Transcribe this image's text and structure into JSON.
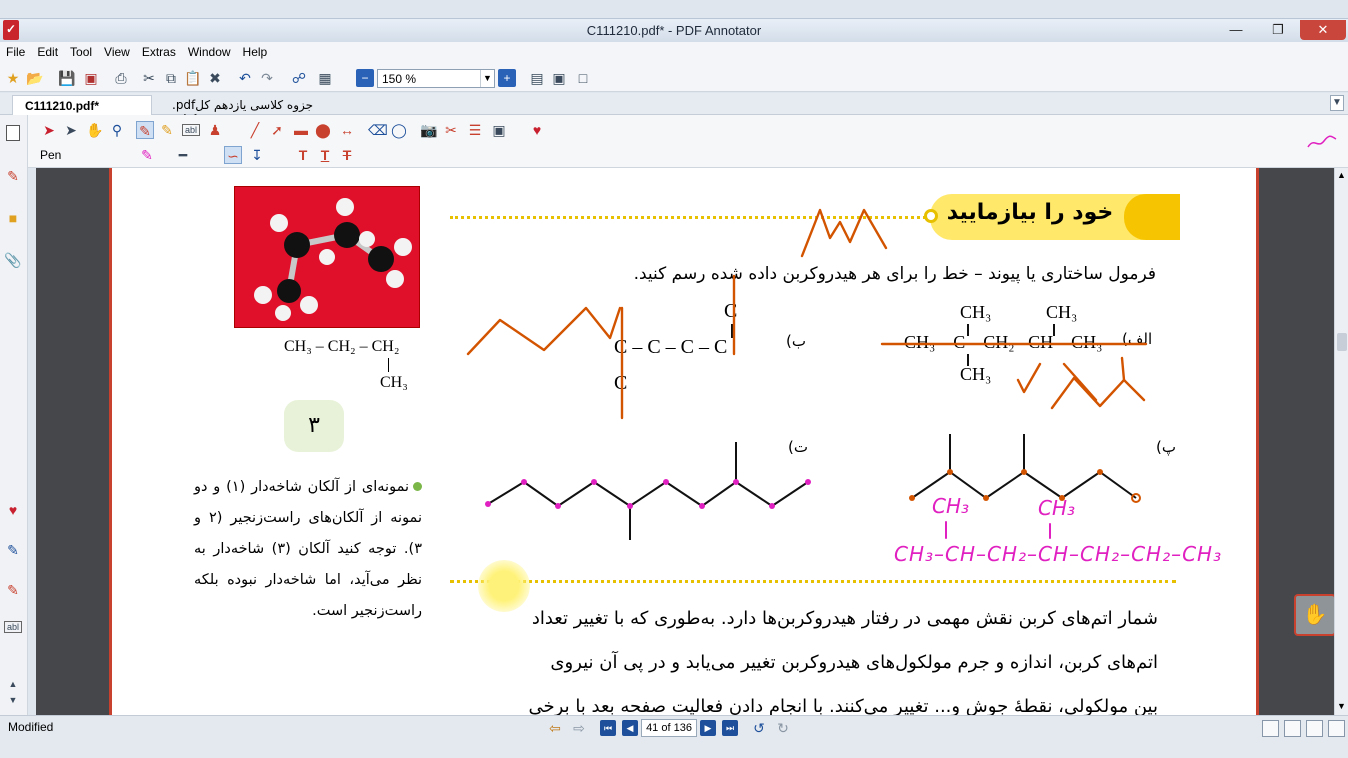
{
  "window": {
    "title": "C111210.pdf* - PDF Annotator"
  },
  "menu": [
    "File",
    "Edit",
    "Tool",
    "View",
    "Extras",
    "Window",
    "Help"
  ],
  "toolbar": {
    "zoom": "150 %"
  },
  "tabs": [
    {
      "label": "C111210.pdf*"
    },
    {
      "label": ".pdfجزوه کلاسی یازدهم کل کتاب"
    }
  ],
  "tool_panel": {
    "current_tool": "Pen"
  },
  "page": {
    "section_title": "خود را بیازمایید",
    "instruction": "فرمول ساختاری یا پیوند – خط را برای هر هیدروکربن داده شده رسم کنید.",
    "label_alef": "الف)",
    "label_be": "ب)",
    "label_pe": "پ)",
    "label_te": "ت)",
    "formula_alef": "CH₃ – C – CH₂ –CH – CH₃",
    "formula_alef_top1": "CH₃",
    "formula_alef_top2": "CH₃",
    "formula_alef_bottom": "CH₃",
    "formula_be_main": "C – C – C – C",
    "formula_be_top": "C",
    "formula_be_bottom": "C",
    "side_formula": "CH₃ – CH₂ – CH₂",
    "side_formula_sub": "CH₃",
    "badge_number": "۳",
    "side_note": "نمونه‌ای از آلکان شاخه‌دار (۱) و دو نمونه از آلکان‌های راست‌زنجیر (۲ و ۳). توجه کنید آلکان (۳) شاخه‌دار به نظر می‌آید، اما شاخه‌دار نبوده بلکه راست‌زنجیر است.",
    "body_line1": "شمار اتم‌های کربن نقش مهمی در رفتار هیدروکربن‌ها دارد. به‌طوری که با تغییر تعداد",
    "body_line2": "اتم‌های کربن، اندازه و جرم مولکول‌های هیدروکربن تغییر می‌یابد و در پی آن نیروی",
    "body_line3": "بین مولکولی، نقطهٔ جوش و... تغییر می‌کنند. با انجام دادن فعالیت صفحه بعد با برخی"
  },
  "handwriting": {
    "ink_top": "CH₃",
    "ink_chain": "CH₃–CH–CH₂–CH–CH₂–CH₂–CH₃"
  },
  "status": {
    "text": "Modified",
    "page_indicator": "41 of 136"
  },
  "colors": {
    "accent_yellow": "#f6c400",
    "ink_orange": "#d35400",
    "ink_magenta": "#e020c0",
    "page_border": "#c8402e"
  }
}
